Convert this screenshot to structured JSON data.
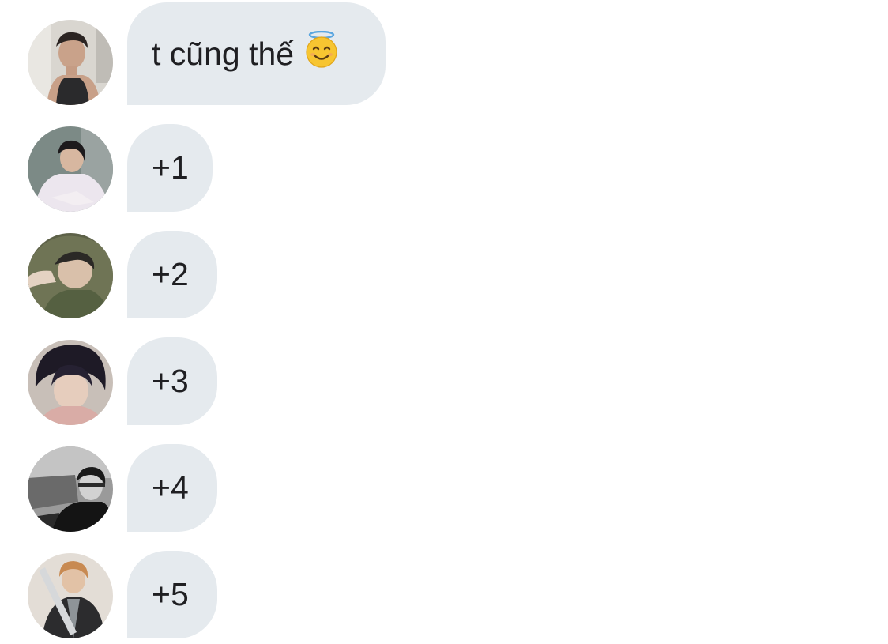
{
  "messages": [
    {
      "text": "t cũng thế",
      "emoji": "smiling-face-with-halo",
      "avatar": "avatar-1"
    },
    {
      "text": "+1",
      "avatar": "avatar-2"
    },
    {
      "text": "+2",
      "avatar": "avatar-3"
    },
    {
      "text": "+3",
      "avatar": "avatar-4"
    },
    {
      "text": "+4",
      "avatar": "avatar-5"
    },
    {
      "text": "+5",
      "avatar": "avatar-6"
    }
  ],
  "colors": {
    "bubble": "#e5eaee",
    "text": "#1f1f22",
    "background": "#ffffff"
  }
}
